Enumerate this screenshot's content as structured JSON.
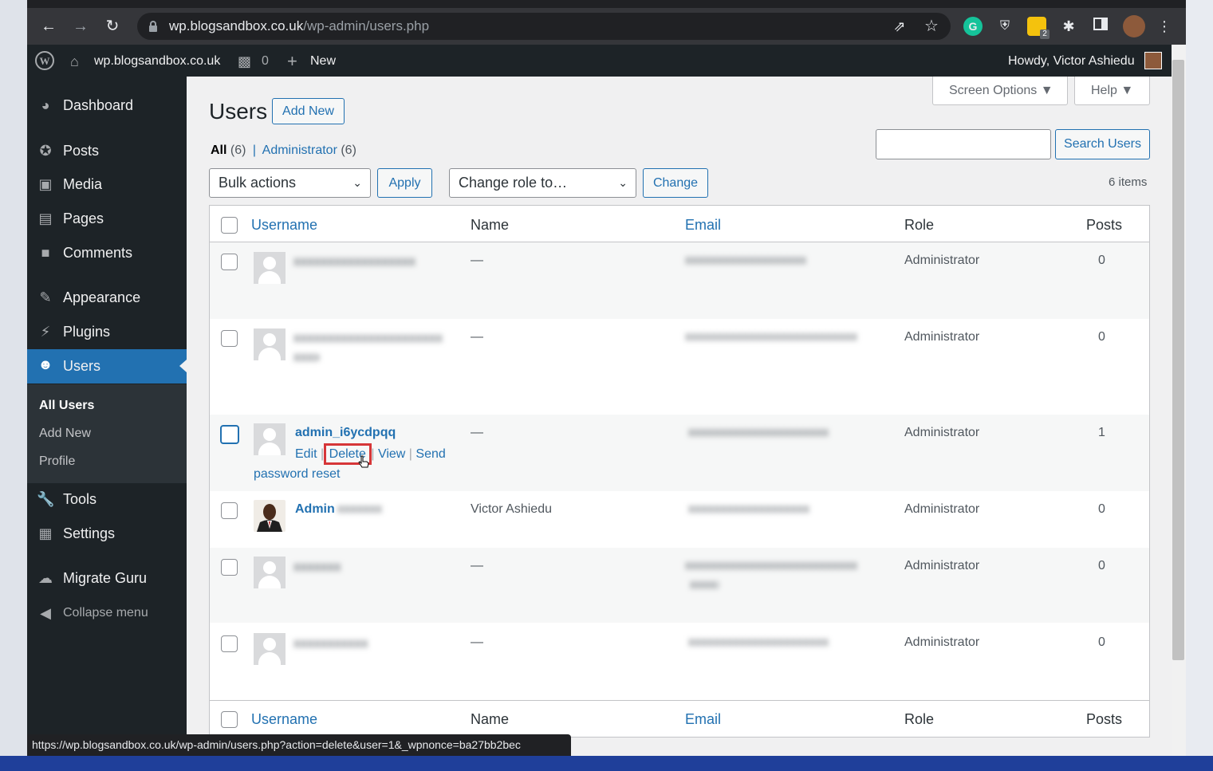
{
  "browser": {
    "url_host": "wp.blogsandbox.co.uk",
    "url_path": "/wp-admin/users.php",
    "extension_badge": "2",
    "status_url": "https://wp.blogsandbox.co.uk/wp-admin/users.php?action=delete&user=1&_wpnonce=ba27bb2bec"
  },
  "adminbar": {
    "site_name": "wp.blogsandbox.co.uk",
    "comments_count": "0",
    "new_label": "New",
    "howdy": "Howdy, Victor Ashiedu"
  },
  "sidebar": {
    "items": [
      {
        "label": "Dashboard",
        "icon": "dashboard-icon"
      },
      {
        "label": "Posts",
        "icon": "pin-icon"
      },
      {
        "label": "Media",
        "icon": "media-icon"
      },
      {
        "label": "Pages",
        "icon": "pages-icon"
      },
      {
        "label": "Comments",
        "icon": "comment-icon"
      },
      {
        "label": "Appearance",
        "icon": "brush-icon"
      },
      {
        "label": "Plugins",
        "icon": "plugin-icon"
      },
      {
        "label": "Users",
        "icon": "user-icon"
      },
      {
        "label": "Tools",
        "icon": "wrench-icon"
      },
      {
        "label": "Settings",
        "icon": "settings-icon"
      },
      {
        "label": "Migrate Guru",
        "icon": "migrate-icon"
      },
      {
        "label": "Collapse menu",
        "icon": "collapse-icon"
      }
    ],
    "submenu": [
      "All Users",
      "Add New",
      "Profile"
    ]
  },
  "page": {
    "title": "Users",
    "add_new": "Add New",
    "screen_options": "Screen Options",
    "help": "Help",
    "search_button": "Search Users",
    "search_value": "",
    "filter_all": "All",
    "filter_all_count": "(6)",
    "filter_admin": "Administrator",
    "filter_admin_count": "(6)",
    "bulk_actions": "Bulk actions",
    "apply": "Apply",
    "change_role": "Change role to…",
    "change": "Change",
    "items_count": "6 items"
  },
  "table": {
    "headers": {
      "username": "Username",
      "name": "Name",
      "email": "Email",
      "role": "Role",
      "posts": "Posts"
    },
    "rows": [
      {
        "username": "xxxxxxxxxxxxxxxxxx",
        "name": "—",
        "email": "xxxxxxxxxxxxxxxxxxx",
        "role": "Administrator",
        "posts": "0"
      },
      {
        "username": "xxxxxxxxxxxxxxxxxxxxxx",
        "name": "—",
        "email": "xxxxxxxxxxxxxxxxxxxxxxxxxxx",
        "role": "Administrator",
        "posts": "0"
      },
      {
        "username": "admin_i6ycdpqq",
        "name": "—",
        "email": "xxxxxxxxxxxxxxxxxxxxxx",
        "role": "Administrator",
        "posts": "1"
      },
      {
        "username": "Admin",
        "name": "Victor Ashiedu",
        "email": "xxxxxxxxxxxxxxxxxxx",
        "role": "Administrator",
        "posts": "0"
      },
      {
        "username": "xxxxxxx",
        "name": "—",
        "email": "xxxxxxxxxxxxxxxxxxxxxxxxxxx",
        "role": "Administrator",
        "posts": "0"
      },
      {
        "username": "xxxxxxxxxxx",
        "name": "—",
        "email": "xxxxxxxxxxxxxxxxxxxxxx",
        "role": "Administrator",
        "posts": "0"
      }
    ],
    "row_actions": {
      "edit": "Edit",
      "delete": "Delete",
      "view": "View",
      "send": "Send",
      "send_cont": "password reset",
      "sep": "|"
    }
  },
  "colors": {
    "accent": "#2271b1",
    "adminbar": "#1d2327",
    "highlight_box": "#d63638"
  }
}
